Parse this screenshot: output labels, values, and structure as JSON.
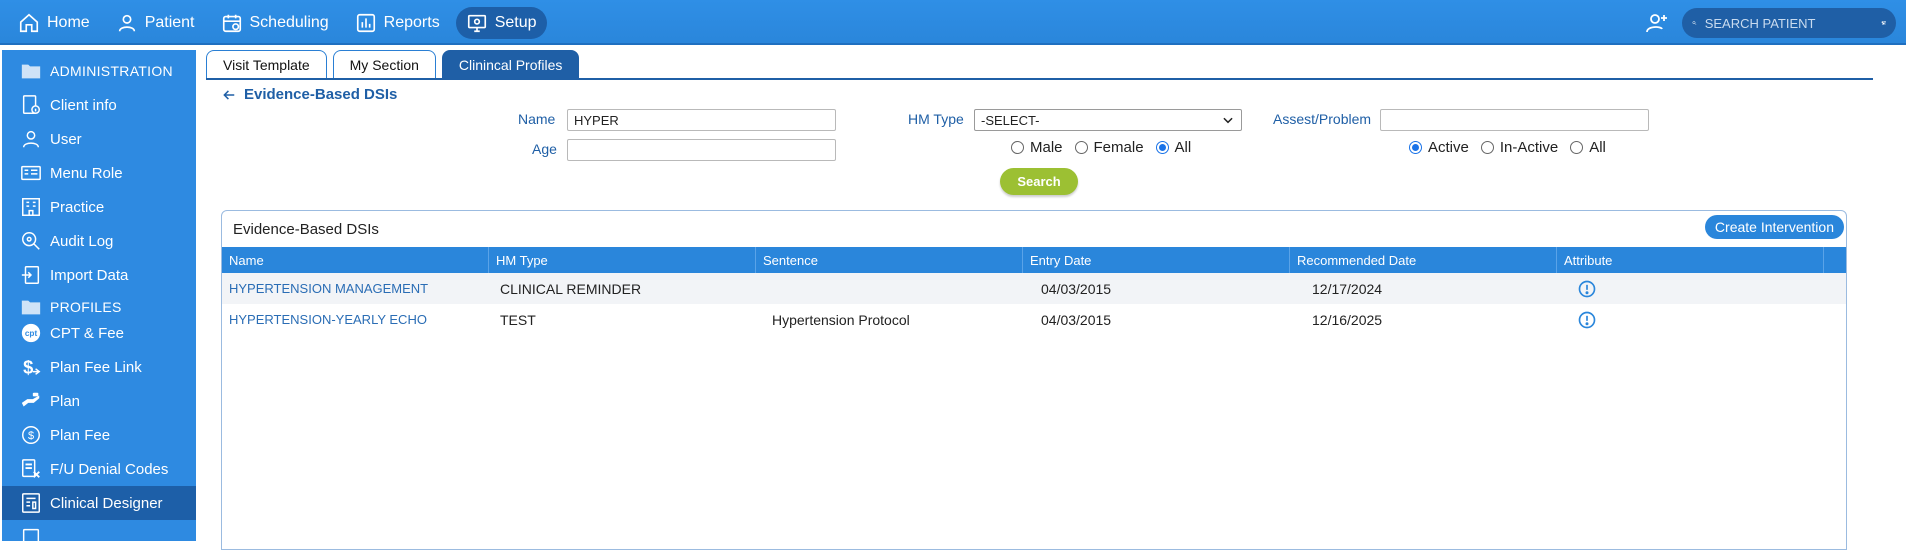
{
  "topbar": {
    "nav": [
      {
        "label": "Home",
        "icon": "home-icon"
      },
      {
        "label": "Patient",
        "icon": "person-icon"
      },
      {
        "label": "Scheduling",
        "icon": "calendar-icon"
      },
      {
        "label": "Reports",
        "icon": "bar-chart-icon"
      },
      {
        "label": "Setup",
        "icon": "monitor-icon",
        "active": true
      }
    ],
    "search_placeholder": "SEARCH PATIENT"
  },
  "sidebar": {
    "items": [
      {
        "label": "ADMINISTRATION",
        "icon": "folder-icon",
        "section": true
      },
      {
        "label": "Client info",
        "icon": "client-info-icon"
      },
      {
        "label": "User",
        "icon": "user-icon"
      },
      {
        "label": "Menu Role",
        "icon": "menu-role-icon"
      },
      {
        "label": "Practice",
        "icon": "practice-icon"
      },
      {
        "label": "Audit Log",
        "icon": "audit-log-icon"
      },
      {
        "label": "Import Data",
        "icon": "import-icon"
      },
      {
        "label": "PROFILES",
        "icon": "folder-icon",
        "section": true
      },
      {
        "label": "CPT & Fee",
        "icon": "cpt-icon"
      },
      {
        "label": "Plan Fee Link",
        "icon": "dollar-icon"
      },
      {
        "label": "Plan",
        "icon": "plan-icon"
      },
      {
        "label": "Plan Fee",
        "icon": "coin-icon"
      },
      {
        "label": "F/U Denial Codes",
        "icon": "denial-icon"
      },
      {
        "label": "Clinical Designer",
        "icon": "designer-icon",
        "active": true
      }
    ]
  },
  "tabs": [
    {
      "label": "Visit Template"
    },
    {
      "label": "My Section"
    },
    {
      "label": "Clinincal Profiles",
      "active": true
    }
  ],
  "page": {
    "back_label": "Evidence-Based DSIs"
  },
  "filters": {
    "name_label": "Name",
    "name_value": "HYPER",
    "age_label": "Age",
    "age_value": "",
    "hm_type_label": "HM Type",
    "hm_type_value": "-SELECT-",
    "assest_label": "Assest/Problem",
    "assest_value": "",
    "gender_options": [
      "Male",
      "Female",
      "All"
    ],
    "gender_selected": "All",
    "status_options": [
      "Active",
      "In-Active",
      "All"
    ],
    "status_selected": "Active",
    "search_label": "Search"
  },
  "results": {
    "title": "Evidence-Based DSIs",
    "create_label": "Create Intervention",
    "columns": [
      "Name",
      "HM Type",
      "Sentence",
      "Entry Date",
      "Recommended Date",
      "Attribute"
    ],
    "rows": [
      {
        "name": "HYPERTENSION MANAGEMENT",
        "hm_type": "CLINICAL REMINDER",
        "sentence": "",
        "entry_date": "04/03/2015",
        "recommended_date": "12/17/2024",
        "attribute_icon": "info-icon"
      },
      {
        "name": "HYPERTENSION-YEARLY ECHO",
        "hm_type": "TEST",
        "sentence": "Hypertension Protocol",
        "entry_date": "04/03/2015",
        "recommended_date": "12/16/2025",
        "attribute_icon": "info-icon"
      }
    ]
  },
  "colors": {
    "primary": "#2a86db",
    "dark": "#1f5fa6",
    "search_button": "#9cc033"
  }
}
